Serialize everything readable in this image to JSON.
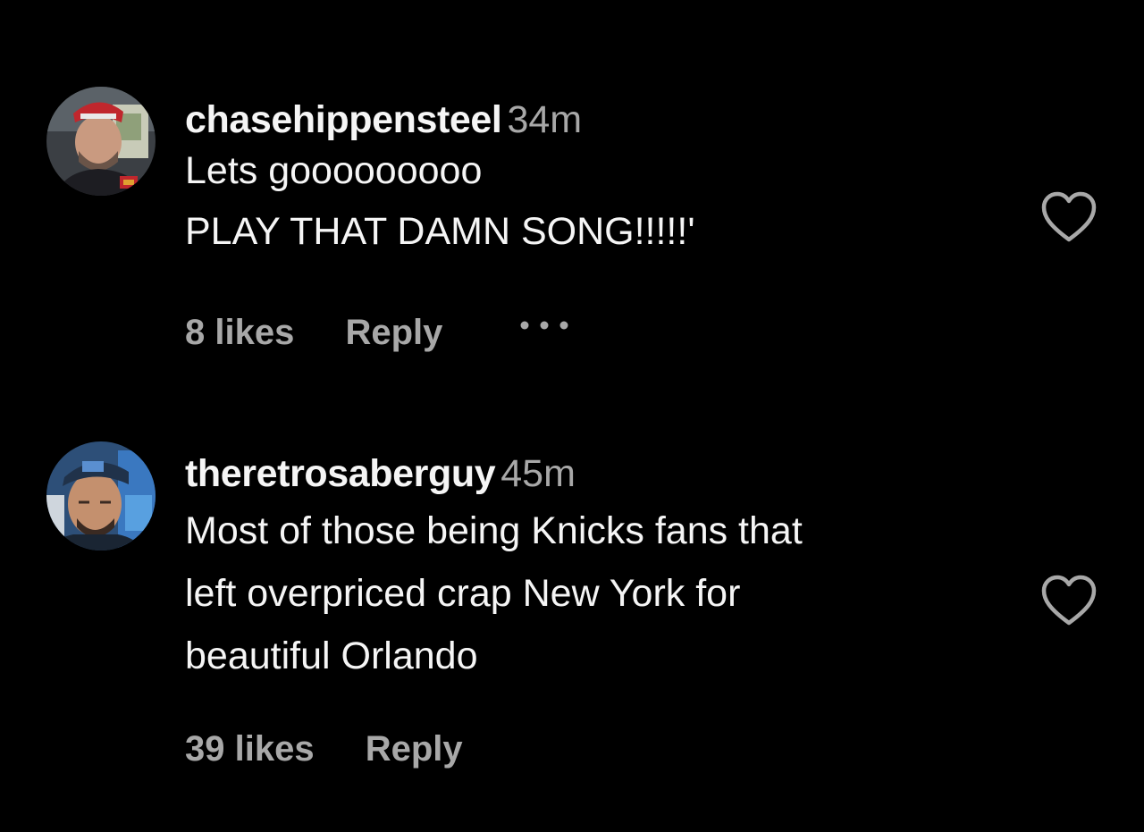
{
  "comments": [
    {
      "username": "chasehippensteel",
      "time": "34m",
      "lines": [
        "Lets gooooooooo",
        "PLAY THAT DAMN SONG!!!!!'"
      ],
      "likes": "8 likes",
      "reply": "Reply",
      "avatar_icon": "user-avatar-red-cap",
      "heart_icon": "heart-outline-icon",
      "more_icon": "ellipsis-icon"
    },
    {
      "username": "theretrosaberguy",
      "time": "45m",
      "lines": [
        "Most of those being Knicks fans that",
        "left overpriced crap New York for",
        "beautiful Orlando"
      ],
      "likes": "39 likes",
      "reply": "Reply",
      "avatar_icon": "user-avatar-blue-cap",
      "heart_icon": "heart-outline-icon"
    }
  ],
  "colors": {
    "background": "#000000",
    "primary_text": "#f5f5f5",
    "secondary_text": "#a8a8a8"
  }
}
